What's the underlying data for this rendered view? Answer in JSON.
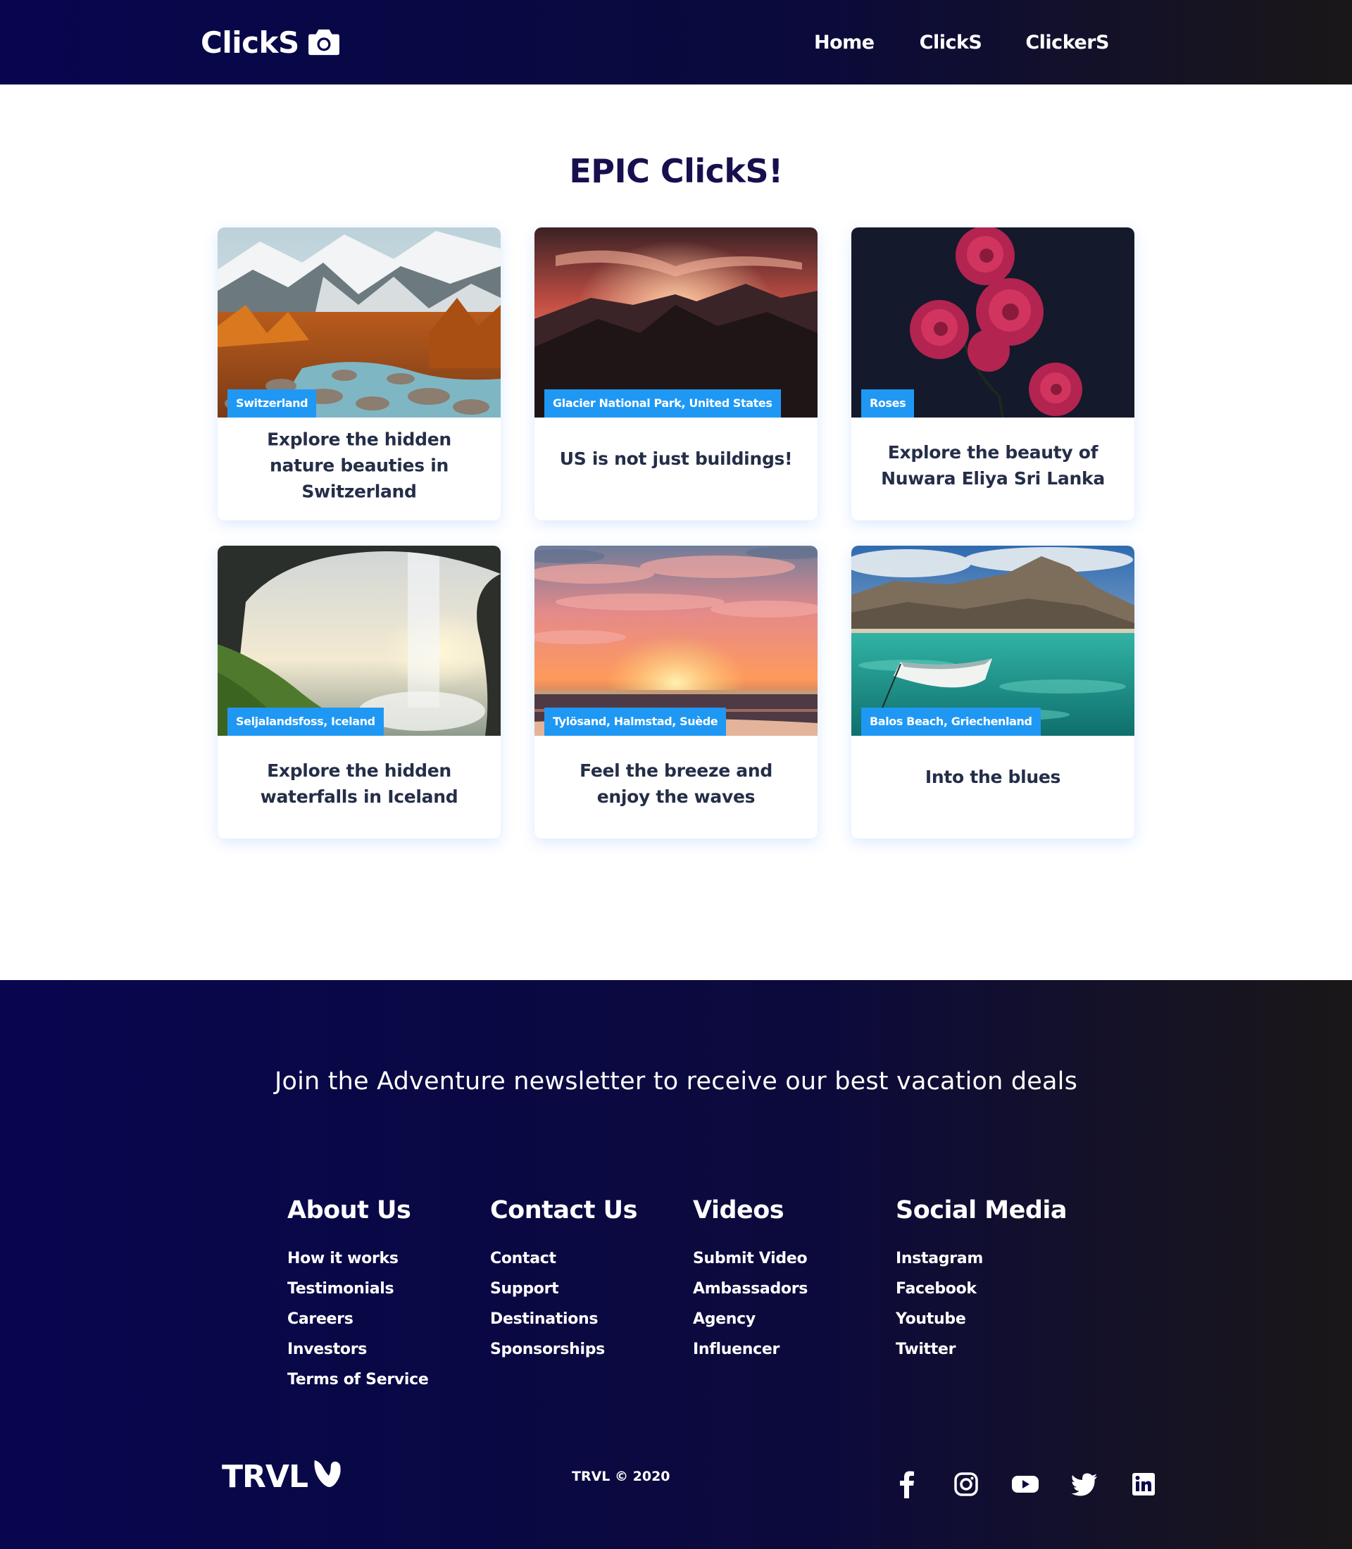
{
  "navbar": {
    "logo_text": "ClickS",
    "logo_icon": "camera-icon",
    "links": [
      "Home",
      "ClickS",
      "ClickerS"
    ]
  },
  "main": {
    "title": "EPIC ClickS!",
    "cards": [
      {
        "tag": "Switzerland",
        "text": "Explore the hidden nature beauties in Switzerland"
      },
      {
        "tag": "Glacier National Park, United States",
        "text": "US is not just buildings!"
      },
      {
        "tag": "Roses",
        "text": "Explore the beauty of Nuwara Eliya Sri Lanka"
      },
      {
        "tag": "Seljalandsfoss, Iceland",
        "text": "Explore the hidden waterfalls in Iceland"
      },
      {
        "tag": "Tylösand, Halmstad, Suède",
        "text": "Feel the breeze and enjoy the waves"
      },
      {
        "tag": "Balos Beach, Griechenland",
        "text": "Into the blues"
      }
    ]
  },
  "footer": {
    "newsletter": "Join the Adventure newsletter to receive our best vacation deals",
    "columns": [
      {
        "title": "About Us",
        "links": [
          "How it works",
          "Testimonials",
          "Careers",
          "Investors",
          "Terms of Service"
        ]
      },
      {
        "title": "Contact Us",
        "links": [
          "Contact",
          "Support",
          "Destinations",
          "Sponsorships"
        ]
      },
      {
        "title": "Videos",
        "links": [
          "Submit Video",
          "Ambassadors",
          "Agency",
          "Influencer"
        ]
      },
      {
        "title": "Social Media",
        "links": [
          "Instagram",
          "Facebook",
          "Youtube",
          "Twitter"
        ]
      }
    ],
    "logo_text": "TRVL",
    "logo_icon": "typo3-icon",
    "copyright": "TRVL © 2020",
    "social_icons": [
      "facebook-icon",
      "instagram-icon",
      "youtube-icon",
      "twitter-icon",
      "linkedin-icon"
    ]
  },
  "colors": {
    "nav_gradient_start": "#07064f",
    "nav_gradient_end": "#1a1718",
    "title_color": "#16104e",
    "tag_bg": "#1f98f4",
    "card_text": "#252e48"
  }
}
